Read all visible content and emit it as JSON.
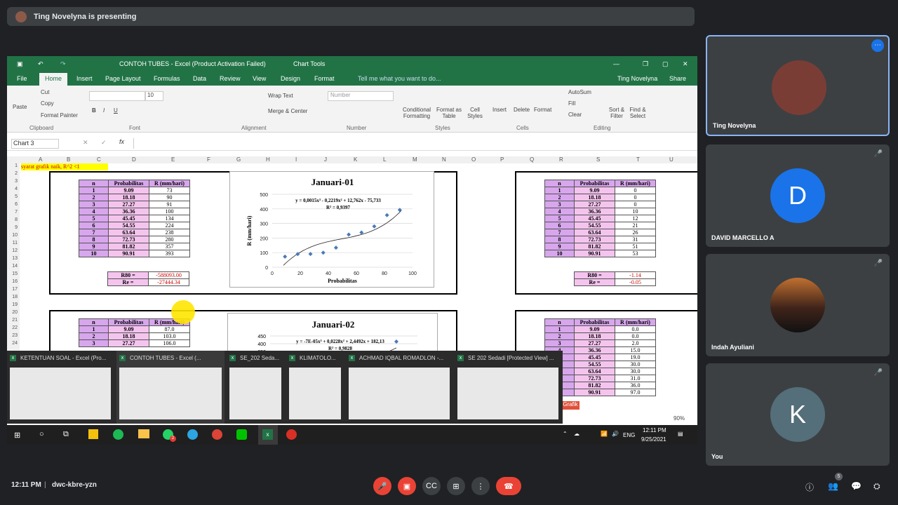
{
  "banner": {
    "presenter_text": "Ting Novelyna is presenting"
  },
  "excel": {
    "title": "CONTOH TUBES - Excel (Product Activation Failed)",
    "chart_tools": "Chart Tools",
    "user": "Ting Novelyna",
    "share": "Share",
    "tabs": [
      "File",
      "Home",
      "Insert",
      "Page Layout",
      "Formulas",
      "Data",
      "Review",
      "View",
      "Design",
      "Format"
    ],
    "tellme": "Tell me what you want to do...",
    "ribbon": {
      "cut": "Cut",
      "copy": "Copy",
      "format_painter": "Format Painter",
      "paste": "Paste",
      "font_size": "10",
      "wrap_text": "Wrap Text",
      "merge_center": "Merge & Center",
      "number_format": "Number",
      "cond_format": "Conditional Formatting",
      "format_table": "Format as Table",
      "cell_styles": "Cell Styles",
      "insert": "Insert",
      "delete": "Delete",
      "format": "Format",
      "autosum": "AutoSum",
      "fill": "Fill",
      "clear": "Clear",
      "sort_filter": "Sort & Filter",
      "find_select": "Find & Select",
      "groups": [
        "Clipboard",
        "Font",
        "Alignment",
        "Number",
        "Styles",
        "Cells",
        "Editing"
      ]
    },
    "name_box": "Chart 3",
    "columns": [
      "A",
      "B",
      "C",
      "D",
      "E",
      "F",
      "G",
      "H",
      "I",
      "J",
      "K",
      "L",
      "M",
      "N",
      "O",
      "P",
      "Q",
      "R",
      "S",
      "T",
      "U"
    ],
    "rows": [
      "1",
      "2",
      "3",
      "4",
      "5",
      "6",
      "7",
      "8",
      "9",
      "10",
      "11",
      "12",
      "13",
      "14",
      "15",
      "16",
      "17",
      "18",
      "19",
      "20",
      "21",
      "22",
      "23",
      "24"
    ],
    "note_cell": "syarat grafik naik, R^2 <1",
    "table_headers": [
      "n",
      "Probabilitas",
      "R (mm/hari)"
    ],
    "table1": {
      "n": [
        "1",
        "2",
        "3",
        "4",
        "5",
        "6",
        "7",
        "8",
        "9",
        "10"
      ],
      "p": [
        "9.09",
        "18.18",
        "27.27",
        "36.36",
        "45.45",
        "54.55",
        "63.64",
        "72.73",
        "81.82",
        "90.91"
      ],
      "r": [
        "73",
        "90",
        "91",
        "100",
        "134",
        "224",
        "238",
        "280",
        "357",
        "393"
      ],
      "r80_label": "R80 =",
      "r80_val": "-588093.00",
      "re_label": "Re =",
      "re_val": "-27444.34"
    },
    "table2": {
      "n": [
        "1",
        "2",
        "3",
        "4",
        "5",
        "6",
        "7",
        "8",
        "9",
        "10"
      ],
      "p": [
        "9.09",
        "18.18",
        "27.27",
        "36.36",
        "45.45",
        "54.55",
        "63.64",
        "72.73",
        "81.82",
        "90.91"
      ],
      "r": [
        "0",
        "0",
        "0",
        "10",
        "12",
        "21",
        "26",
        "31",
        "51",
        "53"
      ],
      "r80_label": "R80 =",
      "r80_val": "-1.14",
      "re_label": "Re =",
      "re_val": "-0.05"
    },
    "table3": {
      "n": [
        "1",
        "2",
        "3"
      ],
      "p": [
        "9.09",
        "18.18",
        "27.27"
      ],
      "r": [
        "87.0",
        "103.0",
        "106.0"
      ]
    },
    "table4": {
      "n": [
        "1",
        "2",
        "3"
      ],
      "p": [
        "9.09",
        "18.18",
        "27.27",
        "36.36",
        "45.45",
        "54.55",
        "63.64",
        "72.73",
        "81.82",
        "90.91"
      ],
      "r": [
        "0.0",
        "0.0",
        "2.0",
        "15.0",
        "19.0",
        "30.0",
        "30.0",
        "31.0",
        "36.0",
        "97.0"
      ]
    },
    "chart1_title": "Januari-01",
    "chart1_eq": "y = 0,0015x³ - 0,2219x² + 12,762x - 75,733",
    "chart1_r2": "R² = 0,9397",
    "chart1_xlabel": "Probabilitas",
    "chart1_ylabel": "R (mm/hari)",
    "chart2_title": "Januari-02",
    "chart2_eq": "y = -7E-05x³ + 0,0228x² + 2,4492x + 182,13",
    "chart2_r2": "R² = 0,9828",
    "sheet_tab": "Grafik",
    "zoom": "90%"
  },
  "chart_data": [
    {
      "type": "scatter",
      "title": "Januari-01",
      "xlabel": "Probabilitas",
      "ylabel": "R (mm/hari)",
      "x": [
        9.09,
        18.18,
        27.27,
        36.36,
        45.45,
        54.55,
        63.64,
        72.73,
        81.82,
        90.91
      ],
      "y": [
        73,
        90,
        91,
        100,
        134,
        224,
        238,
        280,
        357,
        393
      ],
      "xlim": [
        0,
        100
      ],
      "ylim": [
        0,
        500
      ],
      "xticks": [
        "0",
        "20",
        "40",
        "60",
        "80",
        "100"
      ],
      "yticks": [
        "0",
        "100",
        "200",
        "300",
        "400",
        "500"
      ],
      "grid": true
    },
    {
      "type": "scatter",
      "title": "Januari-02",
      "y_ticks_visible": [
        "450",
        "400",
        "350"
      ]
    }
  ],
  "thumbnails": [
    "KETENTUAN SOAL - Excel (Pro...",
    "CONTOH TUBES - Excel (...",
    "SE_202 Seda...",
    "KLIMATOLO...",
    "ACHMAD IQBAL ROMADLON -...",
    "SE 202 Sedadi [Protected View] ..."
  ],
  "taskbar": {
    "lang": "ENG",
    "time": "12:11 PM",
    "date": "9/25/2021",
    "badge": "2"
  },
  "participants": [
    {
      "name": "Ting Novelyna",
      "initial": ""
    },
    {
      "name": "DAVID MARCELLO A",
      "initial": "D"
    },
    {
      "name": "Indah Ayuliani",
      "initial": ""
    },
    {
      "name": "You",
      "initial": "K"
    }
  ],
  "meeting": {
    "time": "12:11 PM",
    "code": "dwc-kbre-yzn",
    "people_count": "5"
  },
  "colors": {
    "excel_green": "#217346",
    "meet_bg": "#202124",
    "tile_bg": "#3c4043",
    "end_call": "#ea4335",
    "avatar_d": "#1a73e8",
    "avatar_k": "#546e7a"
  }
}
